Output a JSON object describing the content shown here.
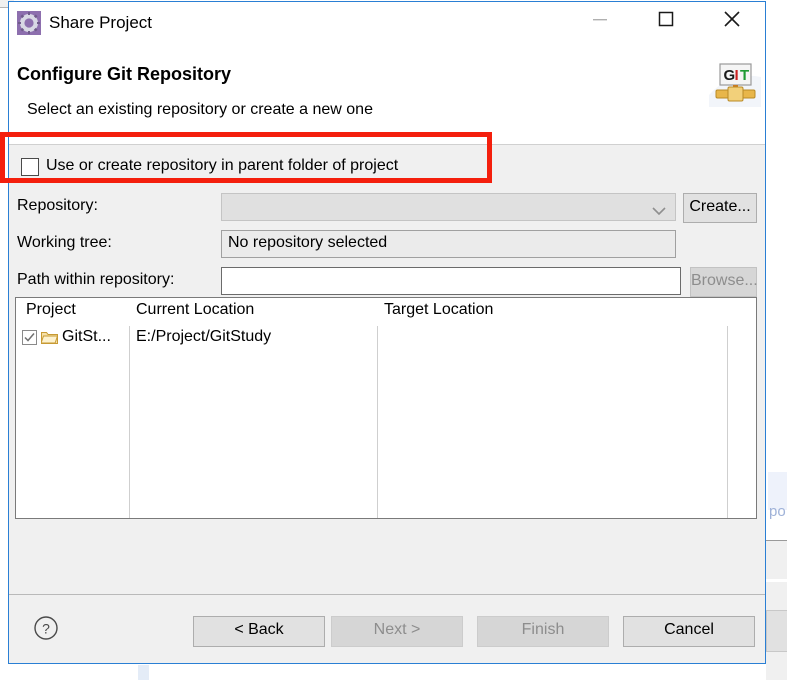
{
  "window": {
    "title": "Share Project",
    "app_icon": "gear-icon",
    "controls": {
      "minimize": "minimize-icon",
      "maximize": "maximize-icon",
      "close": "close-icon"
    }
  },
  "header": {
    "title": "Configure Git Repository",
    "description": "Select an existing repository or create a new one",
    "logo": "git-logo",
    "logo_letters": {
      "g": "G",
      "i": "I",
      "t": "T"
    }
  },
  "parent_option": {
    "label": "Use or create repository in parent folder of project",
    "checked": false
  },
  "form": {
    "rows": [
      {
        "label": "Repository:",
        "value": "",
        "control": "combo",
        "enabled": false
      },
      {
        "label": "Working tree:",
        "value": "No repository selected",
        "control": "readonly-text",
        "enabled": false
      },
      {
        "label": "Path within repository:",
        "value": "",
        "control": "text",
        "enabled": true
      }
    ],
    "create_button": {
      "label": "Create...",
      "enabled": true
    },
    "browse_button": {
      "label": "Browse...",
      "enabled": false
    }
  },
  "table": {
    "columns": [
      "Project",
      "Current Location",
      "Target Location"
    ],
    "rows": [
      {
        "checked": true,
        "icon": "folder-icon",
        "project": "GitSt...",
        "current_location": "E:/Project/GitStudy",
        "target_location": ""
      }
    ]
  },
  "footer": {
    "help_icon": "help-icon",
    "buttons": [
      {
        "label": "< Back",
        "enabled": true
      },
      {
        "label": "Next >",
        "enabled": false
      },
      {
        "label": "Finish",
        "enabled": false
      },
      {
        "label": "Cancel",
        "enabled": true
      }
    ]
  },
  "annotation": {
    "shape": "rectangle",
    "color": "#f41f0d"
  },
  "colors": {
    "window_border": "#2a7fd4",
    "dialog_background": "#f0f0f0",
    "header_background": "#ffffff",
    "annotation_red": "#f41f0d"
  }
}
